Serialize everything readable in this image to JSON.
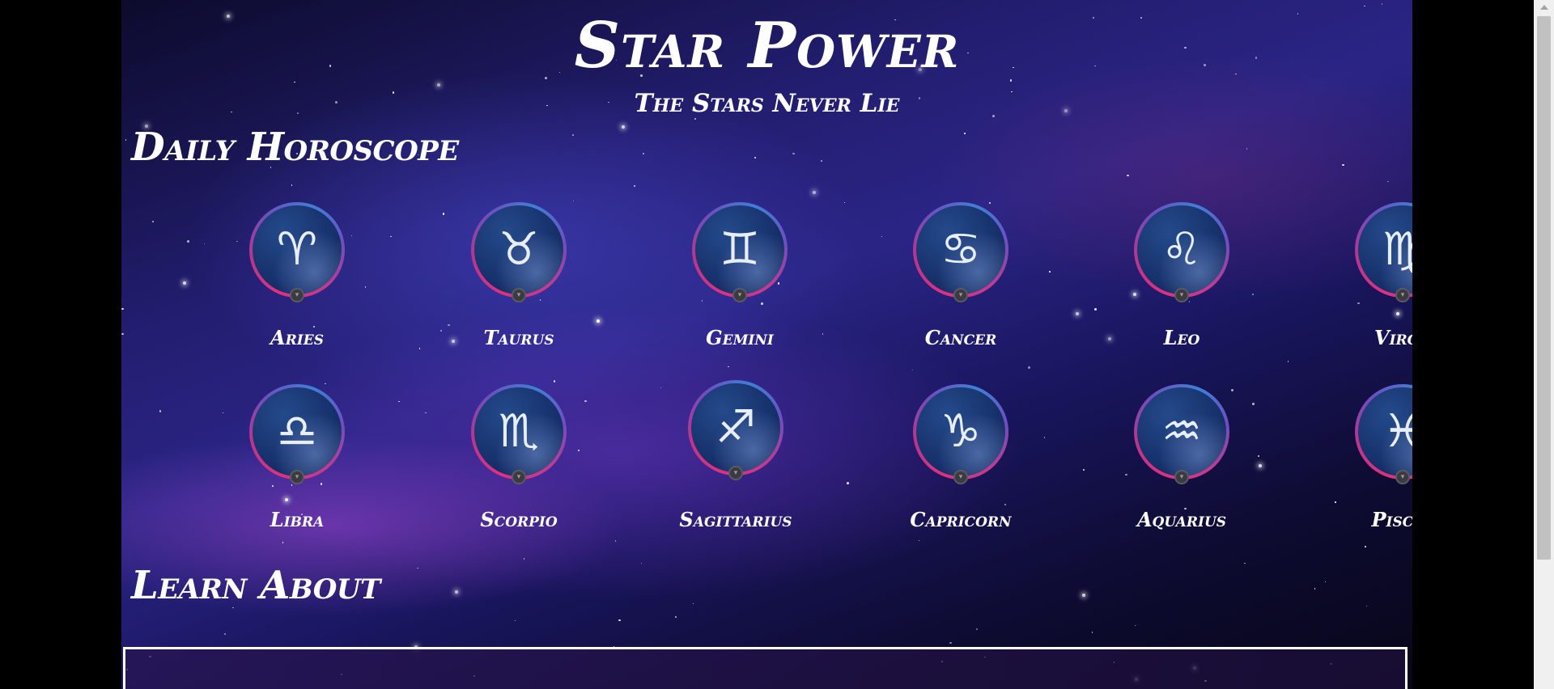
{
  "header": {
    "title": "Star Power",
    "tagline": "The Stars Never Lie"
  },
  "sections": {
    "daily_horoscope": "Daily Horoscope",
    "learn_about": "Learn About"
  },
  "signs": [
    {
      "name": "Aries",
      "glyph": "♈",
      "icon": "aries-icon"
    },
    {
      "name": "Taurus",
      "glyph": "♉",
      "icon": "taurus-icon"
    },
    {
      "name": "Gemini",
      "glyph": "♊",
      "icon": "gemini-icon"
    },
    {
      "name": "Cancer",
      "glyph": "♋",
      "icon": "cancer-icon"
    },
    {
      "name": "Leo",
      "glyph": "♌",
      "icon": "leo-icon"
    },
    {
      "name": "Virgo",
      "glyph": "♍",
      "icon": "virgo-icon"
    },
    {
      "name": "Libra",
      "glyph": "♎",
      "icon": "libra-icon"
    },
    {
      "name": "Scorpio",
      "glyph": "♏",
      "icon": "scorpio-icon"
    },
    {
      "name": "Sagittarius",
      "glyph": "♐",
      "icon": "sagittarius-icon"
    },
    {
      "name": "Capricorn",
      "glyph": "♑",
      "icon": "capricorn-icon"
    },
    {
      "name": "Aquarius",
      "glyph": "♒",
      "icon": "aquarius-icon"
    },
    {
      "name": "Pisces",
      "glyph": "♓",
      "icon": "pisces-icon"
    }
  ],
  "colors": {
    "ring_pink": "#e0307f",
    "ring_blue": "#3f7fd6",
    "medallion_fill": "#16306a",
    "text": "#ffffff"
  }
}
